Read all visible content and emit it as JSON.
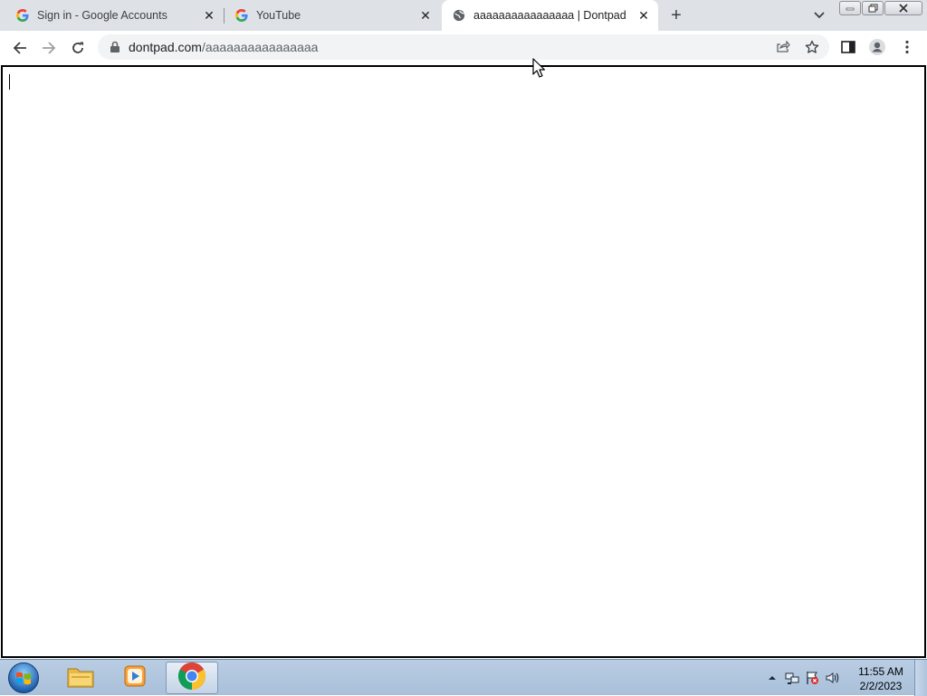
{
  "browser": {
    "tabs": [
      {
        "title": "Sign in - Google Accounts",
        "icon": "google-icon",
        "active": false
      },
      {
        "title": "YouTube",
        "icon": "google-icon",
        "active": false
      },
      {
        "title": "aaaaaaaaaaaaaaaa | Dontpad",
        "icon": "globe-icon",
        "active": true
      }
    ],
    "url_host": "dontpad.com",
    "url_path": "/aaaaaaaaaaaaaaaa"
  },
  "page": {
    "pad_text": ""
  },
  "taskbar": {
    "items": [
      {
        "name": "windows-explorer",
        "icon": "folder-icon"
      },
      {
        "name": "media-player",
        "icon": "media-player-icon"
      },
      {
        "name": "google-chrome",
        "icon": "chrome-icon",
        "active": true
      }
    ],
    "time": "11:55 AM",
    "date": "2/2/2023"
  },
  "colors": {
    "tabstrip_bg": "#dee1e6",
    "omnibox_bg": "#f1f3f4",
    "taskbar_bg": "#a9c0d9"
  }
}
